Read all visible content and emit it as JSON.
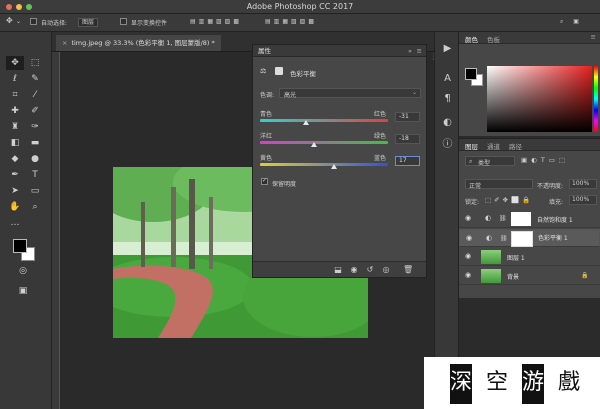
{
  "window": {
    "title": "Adobe Photoshop CC 2017"
  },
  "options_bar": {
    "auto_select_label": "自动选择:",
    "auto_select_value": "图层",
    "show_transform_label": "显示变换控件"
  },
  "document_tab": {
    "label": "timg.jpeg @ 33.3% (色彩平衡 1, 图层蒙版/8) *"
  },
  "properties_panel": {
    "tab": "属性",
    "adjustment_name": "色彩平衡",
    "tone_label": "色调:",
    "tone_value": "高光",
    "sliders": [
      {
        "left": "青色",
        "right": "红色",
        "value": "-31",
        "level": 0.36
      },
      {
        "left": "洋红",
        "right": "绿色",
        "value": "-18",
        "level": 0.42
      },
      {
        "left": "黄色",
        "right": "蓝色",
        "value": "17",
        "level": 0.58
      }
    ],
    "preserve_label": "保留明度",
    "preserve_checked": true
  },
  "color_panel": {
    "tabs": [
      "颜色",
      "色板"
    ],
    "foreground": "#000000",
    "background": "#ffffff",
    "hue": "#e62020"
  },
  "layers_panel": {
    "tabs": [
      "图层",
      "通道",
      "路径"
    ],
    "filter_label": "类型",
    "blend_mode": "正常",
    "opacity_label": "不透明度:",
    "opacity_value": "100%",
    "lock_label": "锁定:",
    "fill_label": "填充:",
    "fill_value": "100%",
    "layers": [
      {
        "name": "自然饱和度 1",
        "kind": "adjustment",
        "selected": false
      },
      {
        "name": "色彩平衡 1",
        "kind": "adjustment",
        "selected": true
      },
      {
        "name": "图层 1",
        "kind": "image",
        "selected": false
      },
      {
        "name": "背景",
        "kind": "image",
        "selected": false
      }
    ]
  },
  "watermark": {
    "chars": [
      "深",
      "空",
      "游",
      "戲"
    ]
  }
}
